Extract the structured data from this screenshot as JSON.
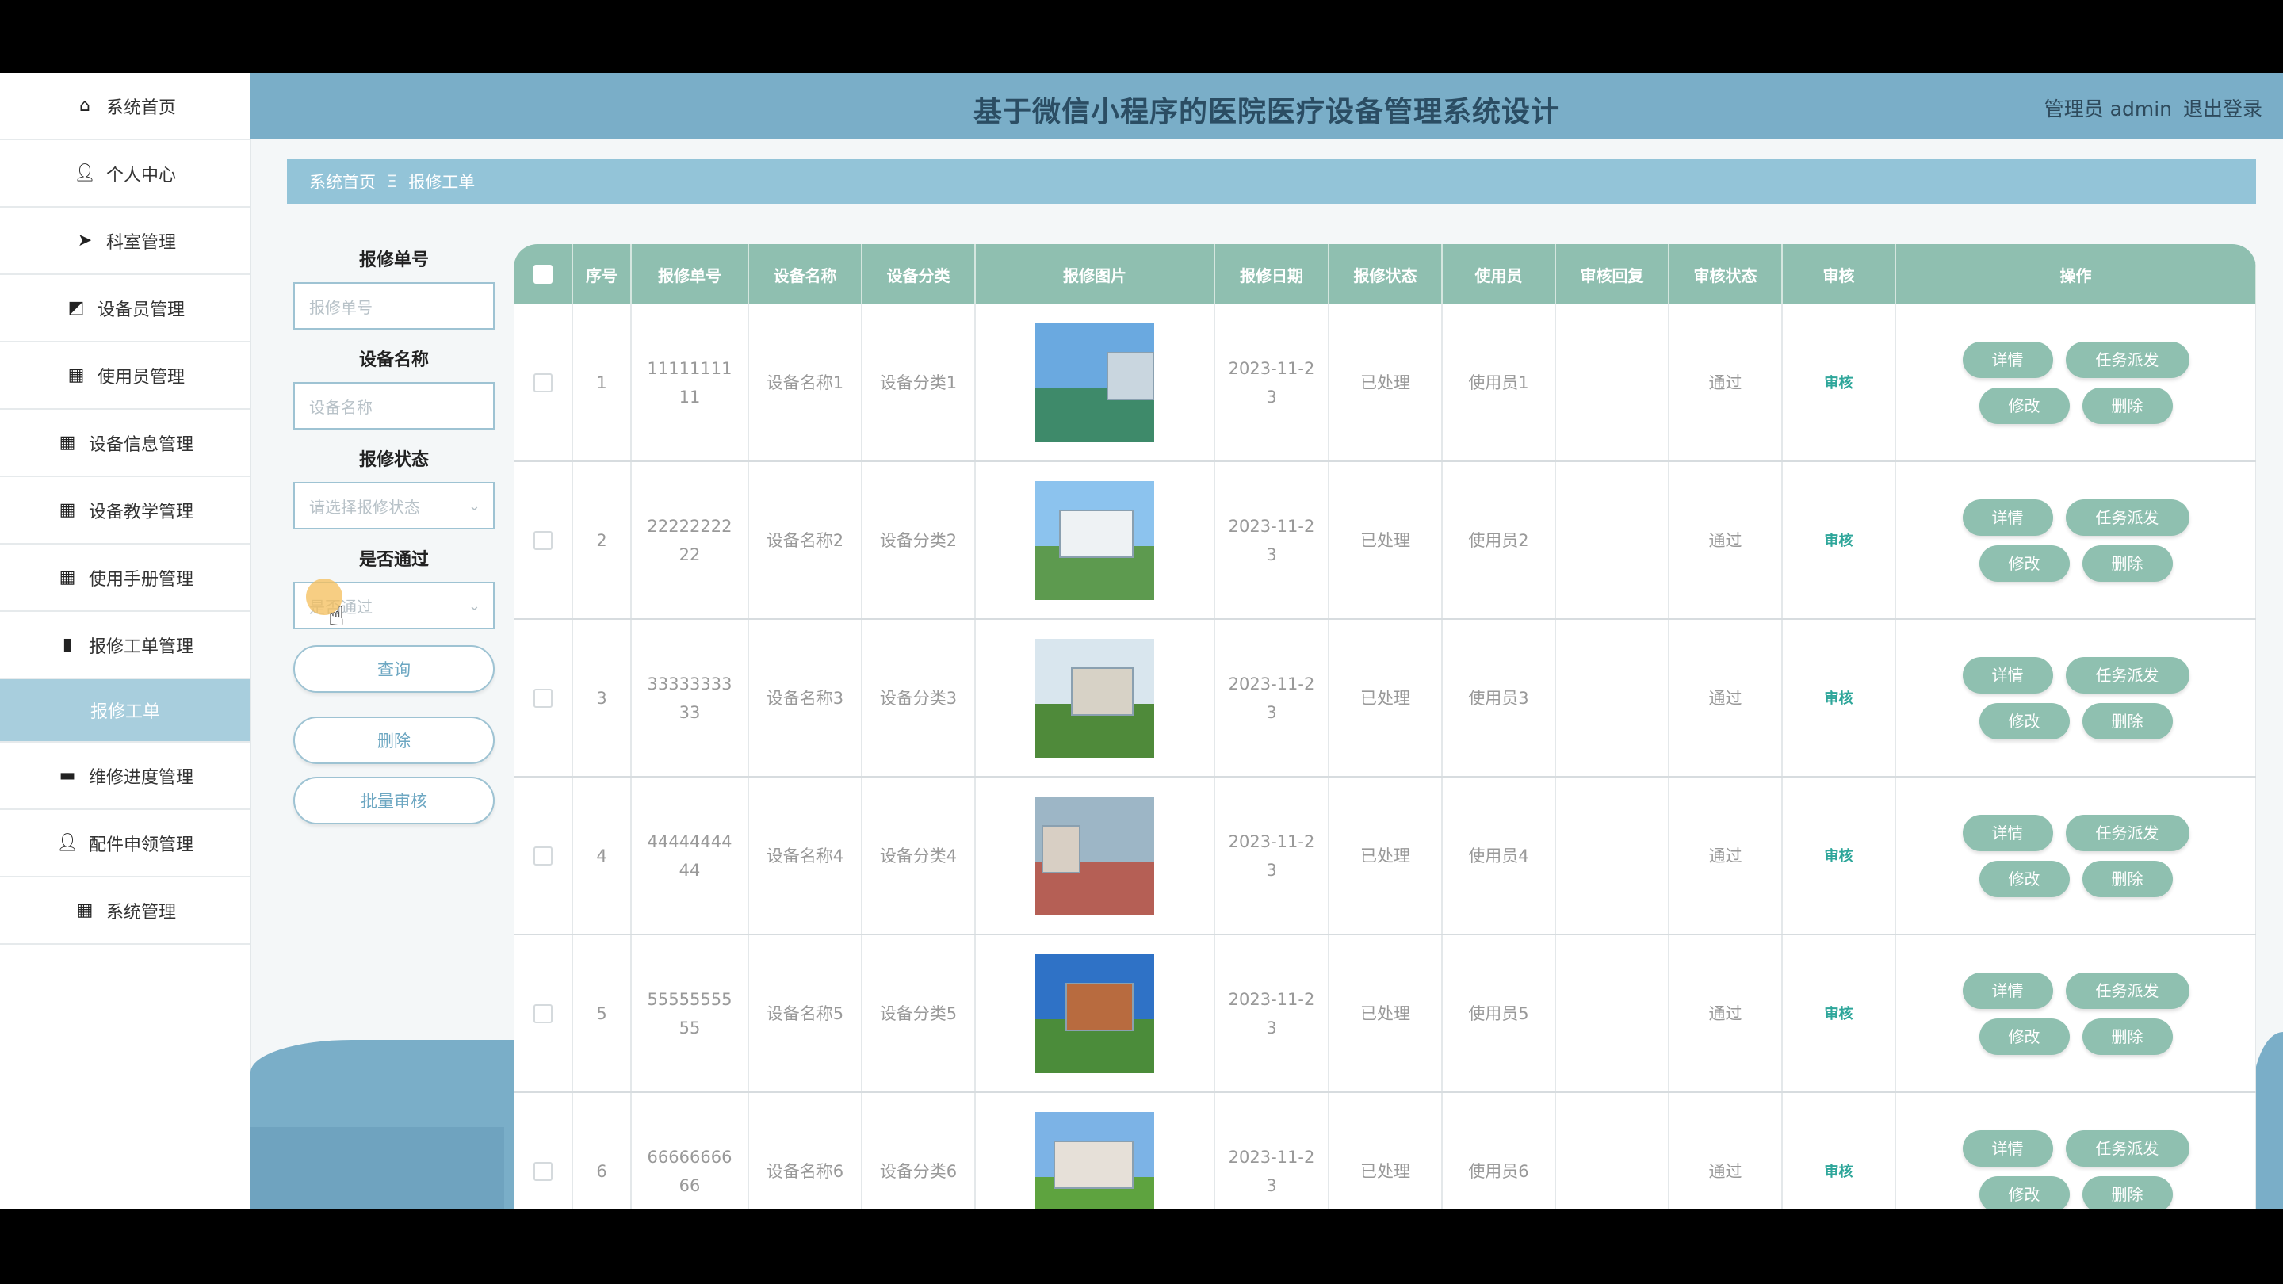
{
  "header": {
    "title": "基于微信小程序的医院医疗设备管理系统设计",
    "user_label": "管理员 admin",
    "logout": "退出登录"
  },
  "sidebar": {
    "items": [
      {
        "label": "系统首页",
        "icon": "home-icon"
      },
      {
        "label": "个人中心",
        "icon": "user-icon"
      },
      {
        "label": "科室管理",
        "icon": "send-icon"
      },
      {
        "label": "设备员管理",
        "icon": "chart-box-icon"
      },
      {
        "label": "使用员管理",
        "icon": "grid-icon"
      },
      {
        "label": "设备信息管理",
        "icon": "grid-icon"
      },
      {
        "label": "设备教学管理",
        "icon": "grid-icon"
      },
      {
        "label": "使用手册管理",
        "icon": "grid-icon"
      },
      {
        "label": "报修工单管理",
        "icon": "bar-chart-icon"
      },
      {
        "label": "报修工单",
        "icon": ""
      },
      {
        "label": "维修进度管理",
        "icon": "briefcase-icon"
      },
      {
        "label": "配件申领管理",
        "icon": "user-icon"
      },
      {
        "label": "系统管理",
        "icon": "grid-icon"
      }
    ]
  },
  "breadcrumb": {
    "home": "系统首页",
    "sep": "Ξ",
    "current": "报修工单"
  },
  "filters": {
    "order_no_label": "报修单号",
    "order_no_placeholder": "报修单号",
    "device_name_label": "设备名称",
    "device_name_placeholder": "设备名称",
    "status_label": "报修状态",
    "status_placeholder": "请选择报修状态",
    "pass_label": "是否通过",
    "pass_placeholder": "是否通过",
    "query": "查询",
    "delete": "删除",
    "batch_audit": "批量审核"
  },
  "table": {
    "columns": [
      "序号",
      "报修单号",
      "设备名称",
      "设备分类",
      "报修图片",
      "报修日期",
      "报修状态",
      "使用员",
      "审核回复",
      "审核状态",
      "审核",
      "操作"
    ],
    "rows": [
      {
        "index": "1",
        "order_no": "1111111111",
        "device": "设备名称1",
        "category": "设备分类1",
        "date": "2023-11-23",
        "status": "已处理",
        "user": "使用员1",
        "reply": "",
        "audit_status": "通过",
        "audit": "审核",
        "image": "campus-track"
      },
      {
        "index": "2",
        "order_no": "2222222222",
        "device": "设备名称2",
        "category": "设备分类2",
        "date": "2023-11-23",
        "status": "已处理",
        "user": "使用员2",
        "reply": "",
        "audit_status": "通过",
        "audit": "审核",
        "image": "campus-building"
      },
      {
        "index": "3",
        "order_no": "3333333333",
        "device": "设备名称3",
        "category": "设备分类3",
        "date": "2023-11-23",
        "status": "已处理",
        "user": "使用员3",
        "reply": "",
        "audit_status": "通过",
        "audit": "审核",
        "image": "campus-trees"
      },
      {
        "index": "4",
        "order_no": "4444444444",
        "device": "设备名称4",
        "category": "设备分类4",
        "date": "2023-11-23",
        "status": "已处理",
        "user": "使用员4",
        "reply": "",
        "audit_status": "通过",
        "audit": "审核",
        "image": "campus-field"
      },
      {
        "index": "5",
        "order_no": "5555555555",
        "device": "设备名称5",
        "category": "设备分类5",
        "date": "2023-11-23",
        "status": "已处理",
        "user": "使用员5",
        "reply": "",
        "audit_status": "通过",
        "audit": "审核",
        "image": "campus-library"
      },
      {
        "index": "6",
        "order_no": "6666666666",
        "device": "设备名称6",
        "category": "设备分类6",
        "date": "2023-11-23",
        "status": "已处理",
        "user": "使用员6",
        "reply": "",
        "audit_status": "通过",
        "audit": "审核",
        "image": "campus-lawn"
      }
    ],
    "actions": {
      "detail": "详情",
      "dispatch": "任务派发",
      "edit": "修改",
      "delete": "删除"
    }
  },
  "colors": {
    "header": "#7aaec8",
    "breadcrumb": "#93c4d8",
    "table_header": "#8fbfb0",
    "pill": "#8fc0b0",
    "audit_link": "#2ea69a",
    "sidebar_active": "#a8cedd"
  }
}
